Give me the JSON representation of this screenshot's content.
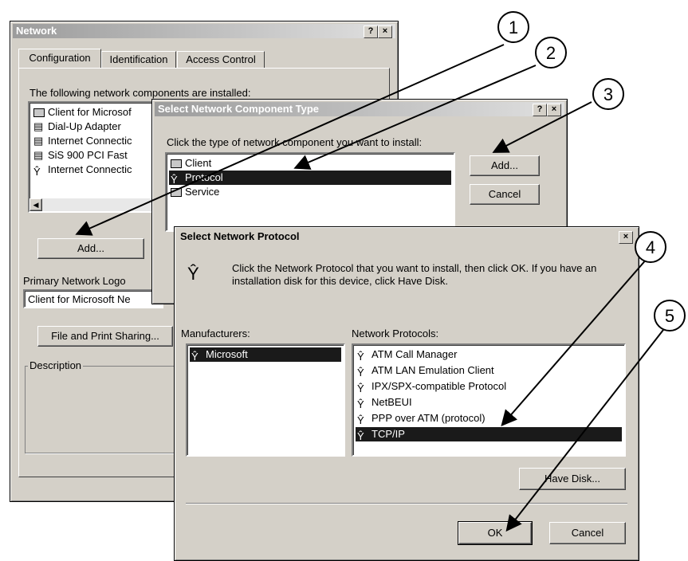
{
  "network": {
    "title": "Network",
    "tabs": [
      "Configuration",
      "Identification",
      "Access Control"
    ],
    "installed_label": "The following network components are installed:",
    "components": [
      "Client for Microsof",
      "Dial-Up Adapter",
      "Internet Connectic",
      "SiS 900 PCI Fast",
      "Internet Connectic"
    ],
    "add_label": "Add...",
    "primary_logon_label": "Primary Network Logo",
    "primary_logon_value": "Client for Microsoft Ne",
    "file_sharing_label": "File and Print Sharing...",
    "description_label": "Description"
  },
  "component_type": {
    "title": "Select Network Component Type",
    "prompt": "Click the type of network component you want to install:",
    "items": [
      "Client",
      "Protocol",
      "Service"
    ],
    "selected": "Protocol",
    "add_label": "Add...",
    "cancel_label": "Cancel"
  },
  "protocol_dialog": {
    "title": "Select Network Protocol",
    "instructions": "Click the Network Protocol that you want to install, then click OK. If you have an installation disk for this device, click Have Disk.",
    "manufacturers_label": "Manufacturers:",
    "manufacturers": [
      "Microsoft"
    ],
    "protocols_label": "Network Protocols:",
    "protocols": [
      "ATM Call Manager",
      "ATM LAN Emulation Client",
      "IPX/SPX-compatible Protocol",
      "NetBEUI",
      "PPP over ATM (protocol)",
      "TCP/IP"
    ],
    "selected_protocol": "TCP/IP",
    "have_disk_label": "Have Disk...",
    "ok_label": "OK",
    "cancel_label": "Cancel"
  },
  "help_glyph": "?",
  "close_glyph": "×",
  "callouts": [
    "1",
    "2",
    "3",
    "4",
    "5"
  ]
}
